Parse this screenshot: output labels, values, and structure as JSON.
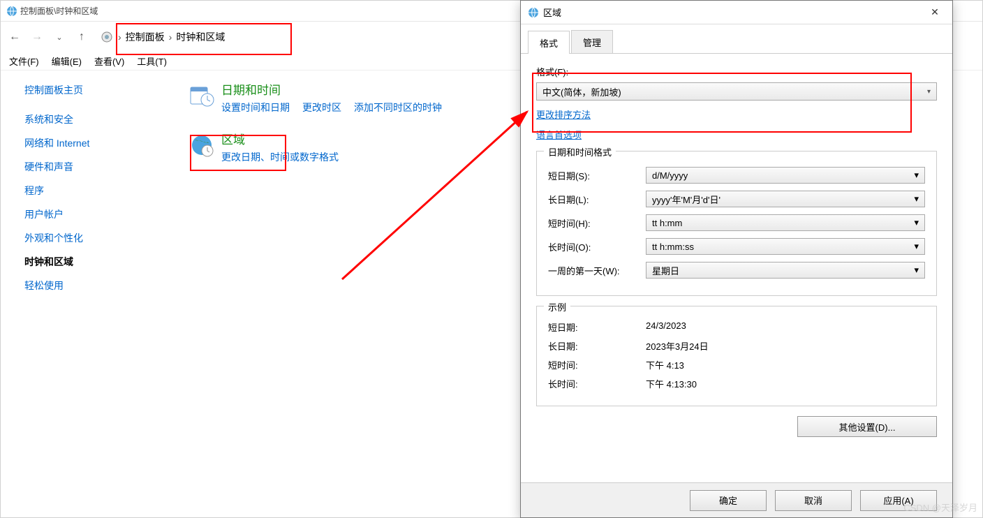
{
  "cp": {
    "title": "控制面板\\时钟和区域",
    "breadcrumb_root": "控制面板",
    "breadcrumb_child": "时钟和区域",
    "menubar": [
      "文件(F)",
      "编辑(E)",
      "查看(V)",
      "工具(T)"
    ],
    "sidebar": {
      "header": "控制面板主页",
      "items": [
        "系统和安全",
        "网络和 Internet",
        "硬件和声音",
        "程序",
        "用户帐户",
        "外观和个性化",
        "时钟和区域",
        "轻松使用"
      ],
      "current_index": 6
    },
    "main": {
      "sections": [
        {
          "title": "日期和时间",
          "links": [
            "设置时间和日期",
            "更改时区",
            "添加不同时区的时钟"
          ]
        },
        {
          "title": "区域",
          "links": [
            "更改日期、时间或数字格式"
          ]
        }
      ]
    }
  },
  "dlg": {
    "title": "区域",
    "tabs": [
      "格式",
      "管理"
    ],
    "active_tab": 0,
    "format_label": "格式(F):",
    "format_value": "中文(简体，新加坡)",
    "link_sort": "更改排序方法",
    "link_lang": "语言首选项",
    "fmt_group_title": "日期和时间格式",
    "fields": {
      "short_date": {
        "label": "短日期(S):",
        "value": "d/M/yyyy"
      },
      "long_date": {
        "label": "长日期(L):",
        "value": "yyyy'年'M'月'd'日'"
      },
      "short_time": {
        "label": "短时间(H):",
        "value": "tt h:mm"
      },
      "long_time": {
        "label": "长时间(O):",
        "value": "tt h:mm:ss"
      },
      "first_day": {
        "label": "一周的第一天(W):",
        "value": "星期日"
      }
    },
    "example_group_title": "示例",
    "examples": {
      "short_date": {
        "label": "短日期:",
        "value": "24/3/2023"
      },
      "long_date": {
        "label": "长日期:",
        "value": "2023年3月24日"
      },
      "short_time": {
        "label": "短时间:",
        "value": "下午 4:13"
      },
      "long_time": {
        "label": "长时间:",
        "value": "下午 4:13:30"
      }
    },
    "other_settings": "其他设置(D)...",
    "buttons": {
      "ok": "确定",
      "cancel": "取消",
      "apply": "应用(A)"
    }
  },
  "watermark": "CSDN @天泽岁月"
}
